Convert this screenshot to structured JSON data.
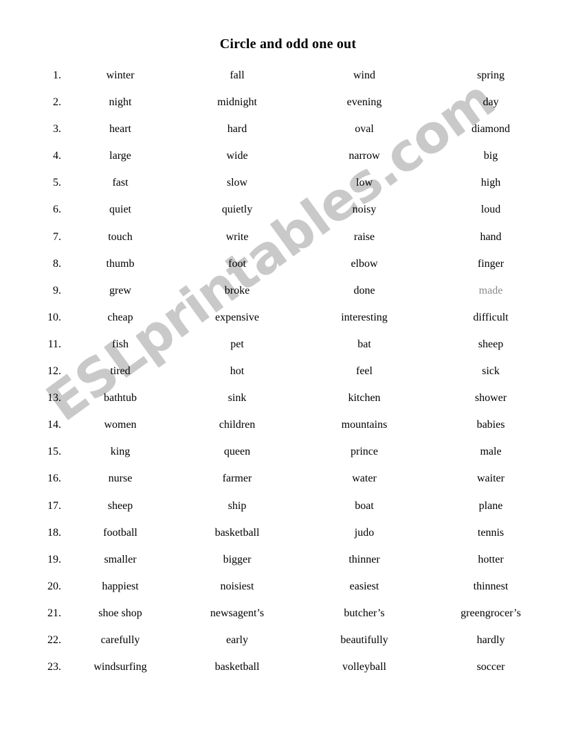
{
  "document": {
    "title": "Circle and odd one out",
    "watermark": "ESLprintables.com",
    "watermark_color": "#c9c9c9",
    "text_color": "#000000",
    "background_color": "#ffffff",
    "faded_text_color": "#8a8a8a",
    "column_count": 4,
    "row_count": 23
  },
  "rows": [
    {
      "number": "1.",
      "words": [
        "winter",
        "fall",
        "wind",
        "spring"
      ]
    },
    {
      "number": "2.",
      "words": [
        "night",
        "midnight",
        "evening",
        "day"
      ]
    },
    {
      "number": "3.",
      "words": [
        "heart",
        "hard",
        "oval",
        "diamond"
      ]
    },
    {
      "number": "4.",
      "words": [
        "large",
        "wide",
        "narrow",
        "big"
      ]
    },
    {
      "number": "5.",
      "words": [
        "fast",
        "slow",
        "low",
        "high"
      ]
    },
    {
      "number": "6.",
      "words": [
        "quiet",
        "quietly",
        "noisy",
        "loud"
      ]
    },
    {
      "number": "7.",
      "words": [
        "touch",
        "write",
        "raise",
        "hand"
      ]
    },
    {
      "number": "8.",
      "words": [
        "thumb",
        "foot",
        "elbow",
        "finger"
      ]
    },
    {
      "number": "9.",
      "words": [
        "grew",
        "broke",
        "done",
        "made"
      ]
    },
    {
      "number": "10.",
      "words": [
        "cheap",
        "expensive",
        "interesting",
        "difficult"
      ]
    },
    {
      "number": "11.",
      "words": [
        "fish",
        "pet",
        "bat",
        "sheep"
      ]
    },
    {
      "number": "12.",
      "words": [
        "tired",
        "hot",
        "feel",
        "sick"
      ]
    },
    {
      "number": "13.",
      "words": [
        "bathtub",
        "sink",
        "kitchen",
        "shower"
      ]
    },
    {
      "number": "14.",
      "words": [
        "women",
        "children",
        "mountains",
        "babies"
      ]
    },
    {
      "number": "15.",
      "words": [
        "king",
        "queen",
        "prince",
        "male"
      ]
    },
    {
      "number": "16.",
      "words": [
        "nurse",
        "farmer",
        "water",
        "waiter"
      ]
    },
    {
      "number": "17.",
      "words": [
        "sheep",
        "ship",
        "boat",
        "plane"
      ]
    },
    {
      "number": "18.",
      "words": [
        "football",
        "basketball",
        "judo",
        "tennis"
      ]
    },
    {
      "number": "19.",
      "words": [
        "smaller",
        "bigger",
        "thinner",
        "hotter"
      ]
    },
    {
      "number": "20.",
      "words": [
        "happiest",
        "noisiest",
        "easiest",
        "thinnest"
      ]
    },
    {
      "number": "21.",
      "words": [
        "shoe shop",
        "newsagent’s",
        "butcher’s",
        "greengrocer’s"
      ]
    },
    {
      "number": "22.",
      "words": [
        "carefully",
        "early",
        "beautifully",
        "hardly"
      ]
    },
    {
      "number": "23.",
      "words": [
        "windsurfing",
        "basketball",
        "volleyball",
        "soccer"
      ]
    }
  ],
  "faded_cells": [
    [
      8,
      3
    ]
  ]
}
